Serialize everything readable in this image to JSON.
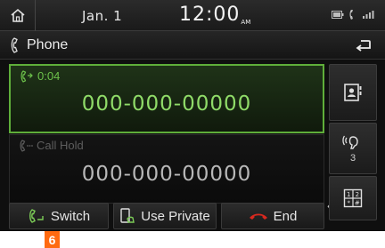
{
  "status_bar": {
    "date": "Jan.  1",
    "time": "12:00",
    "ampm": "AM"
  },
  "header": {
    "title": "Phone"
  },
  "calls": {
    "active": {
      "duration": "0:04",
      "number": "000-000-00000"
    },
    "hold": {
      "status": "Call Hold",
      "number": "000-000-00000"
    }
  },
  "side": {
    "mic_level": "3"
  },
  "buttons": {
    "switch": "Switch",
    "use_private": "Use Private",
    "end": "End"
  },
  "callout": {
    "number": "6"
  },
  "colors": {
    "accent_green": "#5fae3a",
    "end_red": "#d8281e",
    "callout_orange": "#ff6a10"
  },
  "icons": [
    "home-icon",
    "battery-icon",
    "bluetooth-phone-icon",
    "signal-icon",
    "phone-icon",
    "back-arrow-icon",
    "call-active-icon",
    "call-hold-icon",
    "contacts-icon",
    "microphone-volume-icon",
    "keypad-icon",
    "switch-call-icon",
    "use-private-icon",
    "end-call-icon"
  ]
}
